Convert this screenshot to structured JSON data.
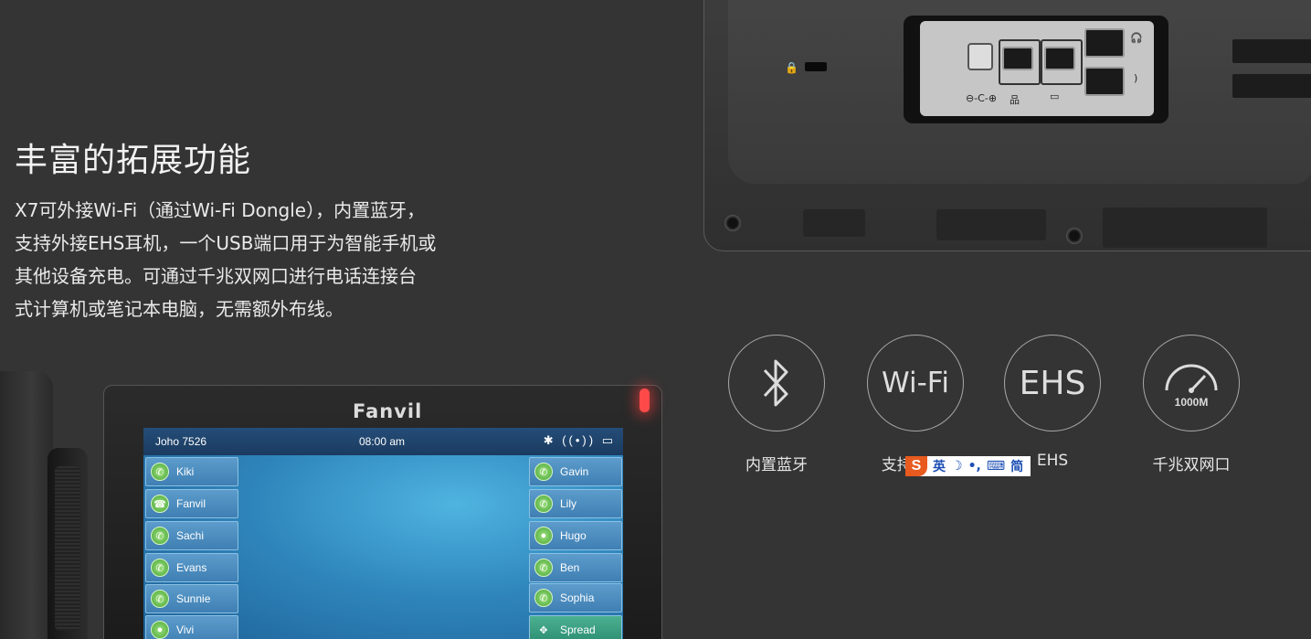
{
  "headline": "丰富的拓展功能",
  "description_lines": [
    "X7可外接Wi-Fi（通过Wi-Fi Dongle），内置蓝牙，",
    "支持外接EHS耳机，一个USB端口用于为智能手机或",
    "其他设备充电。可通过千兆双网口进行电话连接台",
    "式计算机或笔记本电脑，无需额外布线。"
  ],
  "features": [
    {
      "label": "内置蓝牙",
      "icon": "bluetooth-icon",
      "glyph": ""
    },
    {
      "label": "支持Wi-Fi",
      "icon": "wifi-text-icon",
      "glyph": "Wi-Fi"
    },
    {
      "label": "EHS",
      "icon": "ehs-text-icon",
      "glyph": "EHS"
    },
    {
      "label": "千兆双网口",
      "icon": "speedometer-icon",
      "glyph": "1000M"
    }
  ],
  "ime_toolbar": {
    "logo": "S",
    "items": [
      "英",
      "☽",
      "•,",
      "⌨",
      "简"
    ]
  },
  "phone": {
    "brand": "Fanvil",
    "status_user": "Joho  7526",
    "status_time": "08:00 am",
    "status_icons": "✱ ((•)) ▭",
    "left_contacts": [
      "Kiki",
      "Fanvil",
      "Sachi",
      "Evans",
      "Sunnie",
      "Vivi"
    ],
    "right_contacts": [
      "Gavin",
      "Lily",
      "Hugo",
      "Ben",
      "Sophia",
      "Spread"
    ]
  },
  "back_panel": {
    "port_labels": [
      "⊖-C-⊕",
      "品",
      "▭",
      "🎧",
      ")"
    ]
  }
}
